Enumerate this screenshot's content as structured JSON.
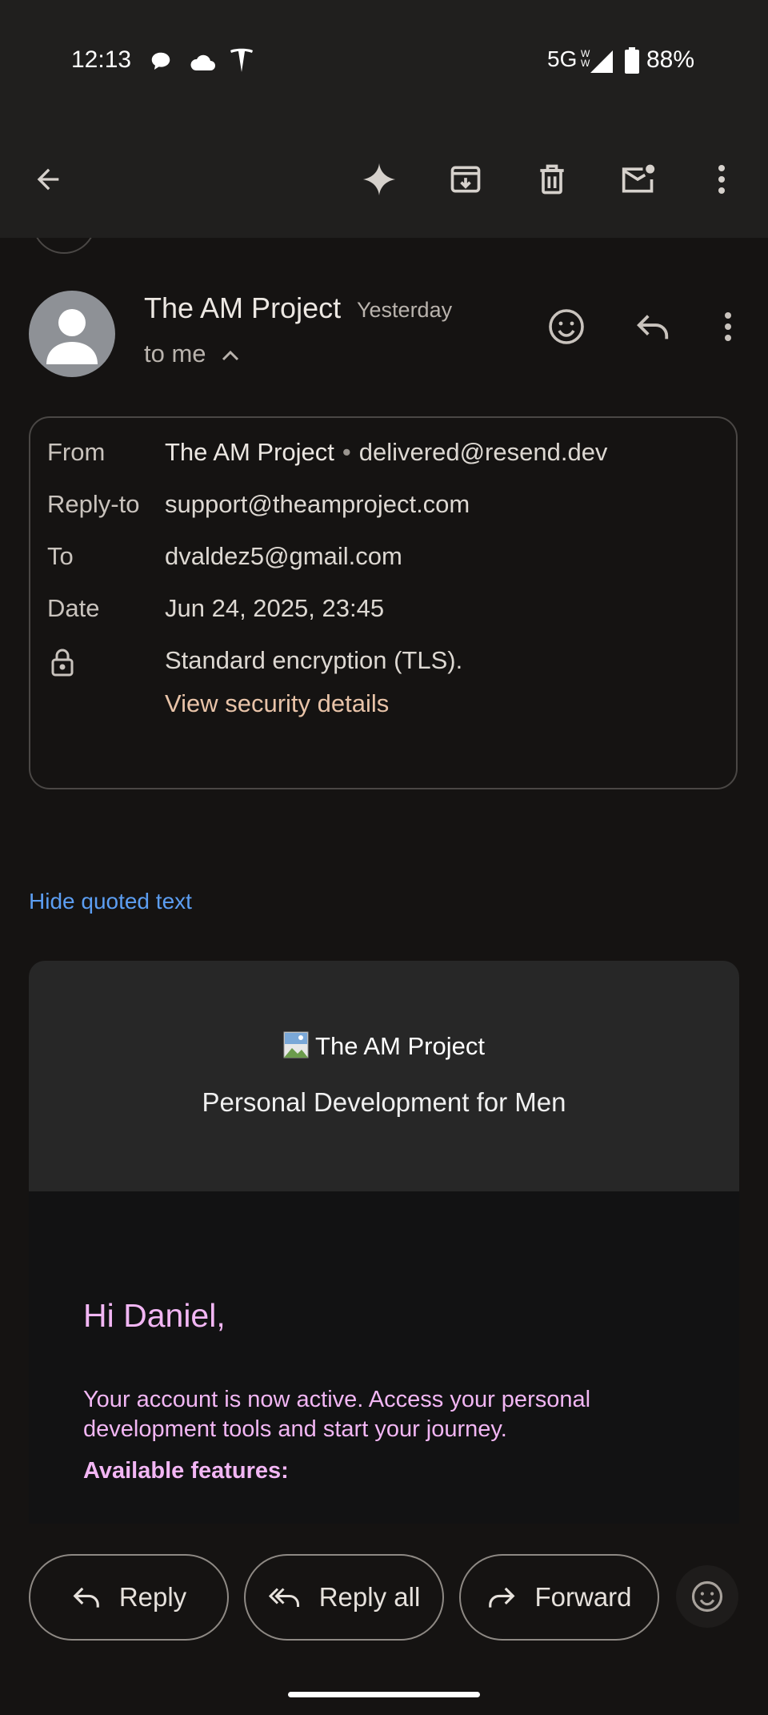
{
  "status_bar": {
    "time": "12:13",
    "network": "5G",
    "battery": "88%",
    "icons": [
      "chat-bubble-icon",
      "cloud-icon",
      "tesla-icon",
      "signal-icon",
      "battery-icon"
    ]
  },
  "toolbar": {
    "icons": [
      "back-arrow-icon",
      "sparkle-icon",
      "archive-icon",
      "delete-icon",
      "mark-unread-icon",
      "more-vert-icon"
    ]
  },
  "email": {
    "sender": "The AM Project",
    "date_short": "Yesterday",
    "recipient_summary": "to me",
    "details": {
      "from_label": "From",
      "from_name": "The AM Project",
      "from_email": "delivered@resend.dev",
      "reply_to_label": "Reply-to",
      "reply_to": "support@theamproject.com",
      "to_label": "To",
      "to": "dvaldez5@gmail.com",
      "date_label": "Date",
      "date": "Jun 24, 2025, 23:45",
      "encryption": "Standard encryption (TLS).",
      "security_link": "View security details"
    },
    "hide_quoted": "Hide quoted text",
    "body": {
      "logo_alt": "The AM Project",
      "tagline": "Personal Development for Men",
      "greeting": "Hi Daniel,",
      "paragraph": "Your account is now active. Access your personal development tools and start your journey.",
      "features_heading": "Available features:"
    }
  },
  "actions": {
    "reply": "Reply",
    "reply_all": "Reply all",
    "forward": "Forward"
  },
  "colors": {
    "background": "#151312",
    "toolbar": "#201f1e",
    "link_blue": "#5c9ef2",
    "security_link": "#e8c3a8",
    "email_pink": "#f2b6f4"
  }
}
